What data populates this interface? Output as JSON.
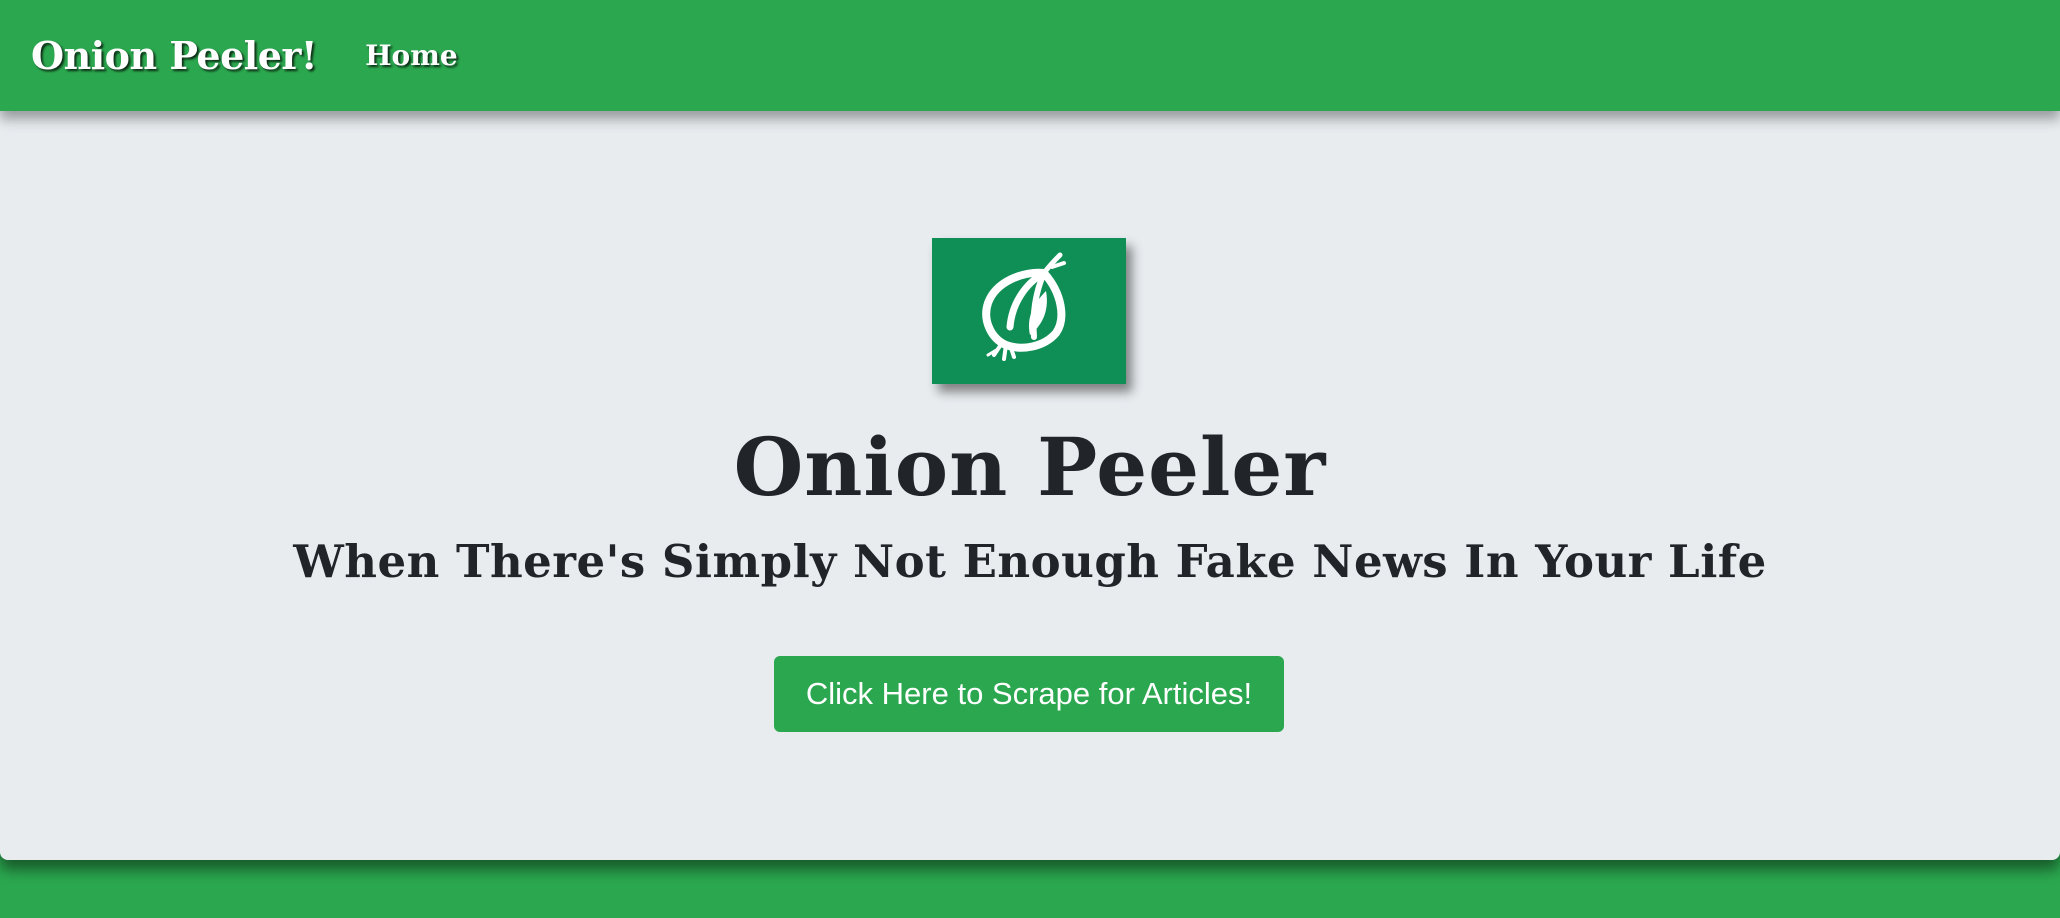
{
  "navbar": {
    "brand": "Onion Peeler!",
    "links": [
      {
        "label": "Home"
      }
    ]
  },
  "hero": {
    "logo_icon": "onion-icon",
    "title": "Onion Peeler",
    "subtitle": "When There's Simply Not Enough Fake News In Your Life",
    "button_label": "Click Here to Scrape for Articles!"
  },
  "colors": {
    "brand_green": "#2ba84f",
    "logo_green": "#0f8f56",
    "jumbotron_bg": "#e8ecef",
    "text_dark": "#212529"
  }
}
